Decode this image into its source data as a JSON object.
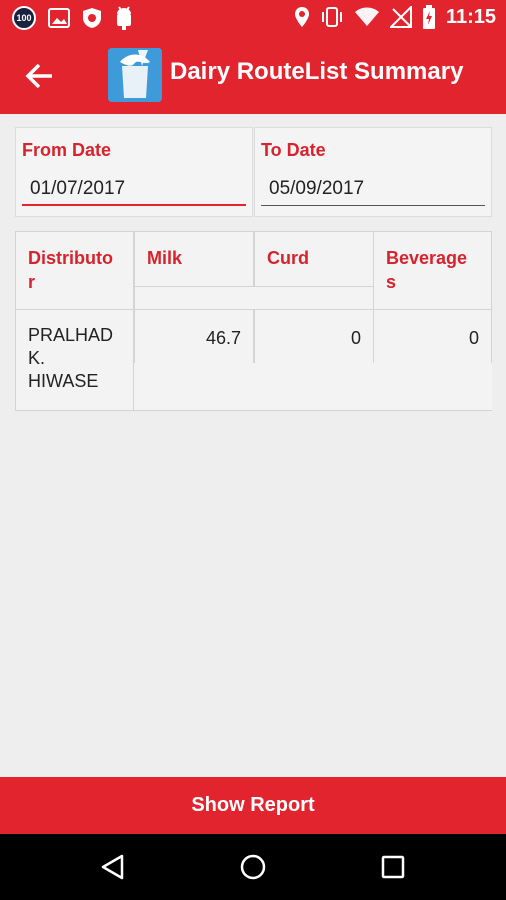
{
  "status_bar": {
    "time": "11:15",
    "badge": "100"
  },
  "app_bar": {
    "title": "Dairy RouteList Summary"
  },
  "filters": {
    "from_label": "From Date",
    "from_value": "01/07/2017",
    "to_label": "To Date",
    "to_value": "05/09/2017"
  },
  "table": {
    "headers": [
      "Distributo\nr",
      "Milk",
      "Curd",
      "Beverage\ns"
    ],
    "rows": [
      {
        "distributor": "PRALHAD\nK.\nHIWASE",
        "milk": "46.7",
        "curd": "0",
        "beverages": "0"
      }
    ]
  },
  "actions": {
    "show_report": "Show Report"
  },
  "colors": {
    "primary": "#e2242f",
    "accent_text": "#d7232d"
  }
}
